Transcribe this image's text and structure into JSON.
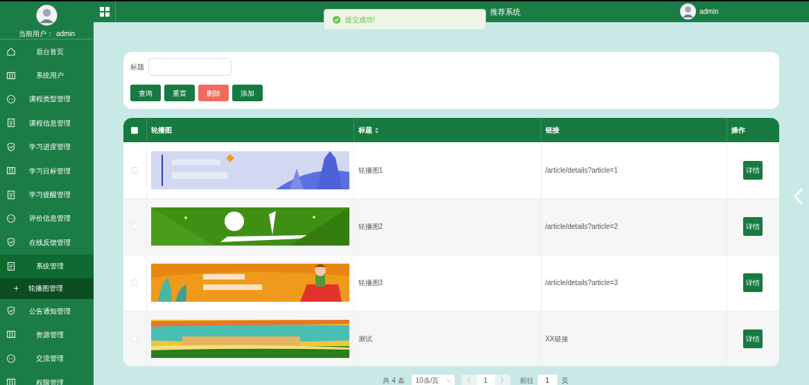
{
  "sidebar": {
    "user_label": "当前用户：",
    "user_name": "admin",
    "items": [
      {
        "label": "后台首页",
        "kind": "home",
        "expanded": false
      },
      {
        "label": "系统用户",
        "kind": "columns",
        "expanded": false
      },
      {
        "label": "课程类型管理",
        "kind": "chat",
        "expanded": false
      },
      {
        "label": "课程信息管理",
        "kind": "doc",
        "expanded": false
      },
      {
        "label": "学习进度管理",
        "kind": "shield",
        "expanded": false
      },
      {
        "label": "学习目标管理",
        "kind": "columns",
        "expanded": false
      },
      {
        "label": "学习提醒管理",
        "kind": "doc",
        "expanded": false
      },
      {
        "label": "评价信息管理",
        "kind": "chat",
        "expanded": false
      },
      {
        "label": "在线反馈管理",
        "kind": "shield",
        "expanded": false
      },
      {
        "label": "系统管理",
        "kind": "doc",
        "expanded": true,
        "children": [
          {
            "label": "轮播图管理",
            "selected": true
          }
        ]
      },
      {
        "label": "公告通知管理",
        "kind": "shield",
        "expanded": false
      },
      {
        "label": "资源管理",
        "kind": "columns",
        "expanded": false
      },
      {
        "label": "交流管理",
        "kind": "chat",
        "expanded": false
      },
      {
        "label": "权限管理",
        "kind": "columns",
        "expanded": false
      }
    ]
  },
  "header": {
    "title": "推荐系统",
    "user_name": "admin"
  },
  "toast": {
    "kind": "success",
    "text": "提交成功!"
  },
  "search": {
    "label": "标题"
  },
  "buttons": [
    {
      "label": "查询",
      "kind": "primary"
    },
    {
      "label": "重置",
      "kind": "primary"
    },
    {
      "label": "删除",
      "kind": "danger"
    },
    {
      "label": "添加",
      "kind": "primary"
    }
  ],
  "table": {
    "select_all_checked": false,
    "columns": [
      {
        "label": "轮播图",
        "sortable": false
      },
      {
        "label": "标题",
        "sortable": true
      },
      {
        "label": "链接",
        "sortable": false
      },
      {
        "label": "操作",
        "sortable": false
      }
    ],
    "rows": [
      {
        "checked": false,
        "title": "轮播图1",
        "link": "/article/details?article=1",
        "action": "详情"
      },
      {
        "checked": false,
        "title": "轮播图2",
        "link": "/article/details?article=2",
        "action": "详情"
      },
      {
        "checked": false,
        "title": "轮播图3",
        "link": "/article/details?article=3",
        "action": "详情"
      },
      {
        "checked": false,
        "title": "测试",
        "link": "XX链接",
        "action": "详情"
      }
    ]
  },
  "pagination": {
    "total": "共 4 条",
    "page_size": "10条/页",
    "pages": [
      {
        "label": "1",
        "selected": true
      }
    ],
    "goto_label": "前往",
    "goto_value": "1",
    "goto_suffix": "页"
  }
}
